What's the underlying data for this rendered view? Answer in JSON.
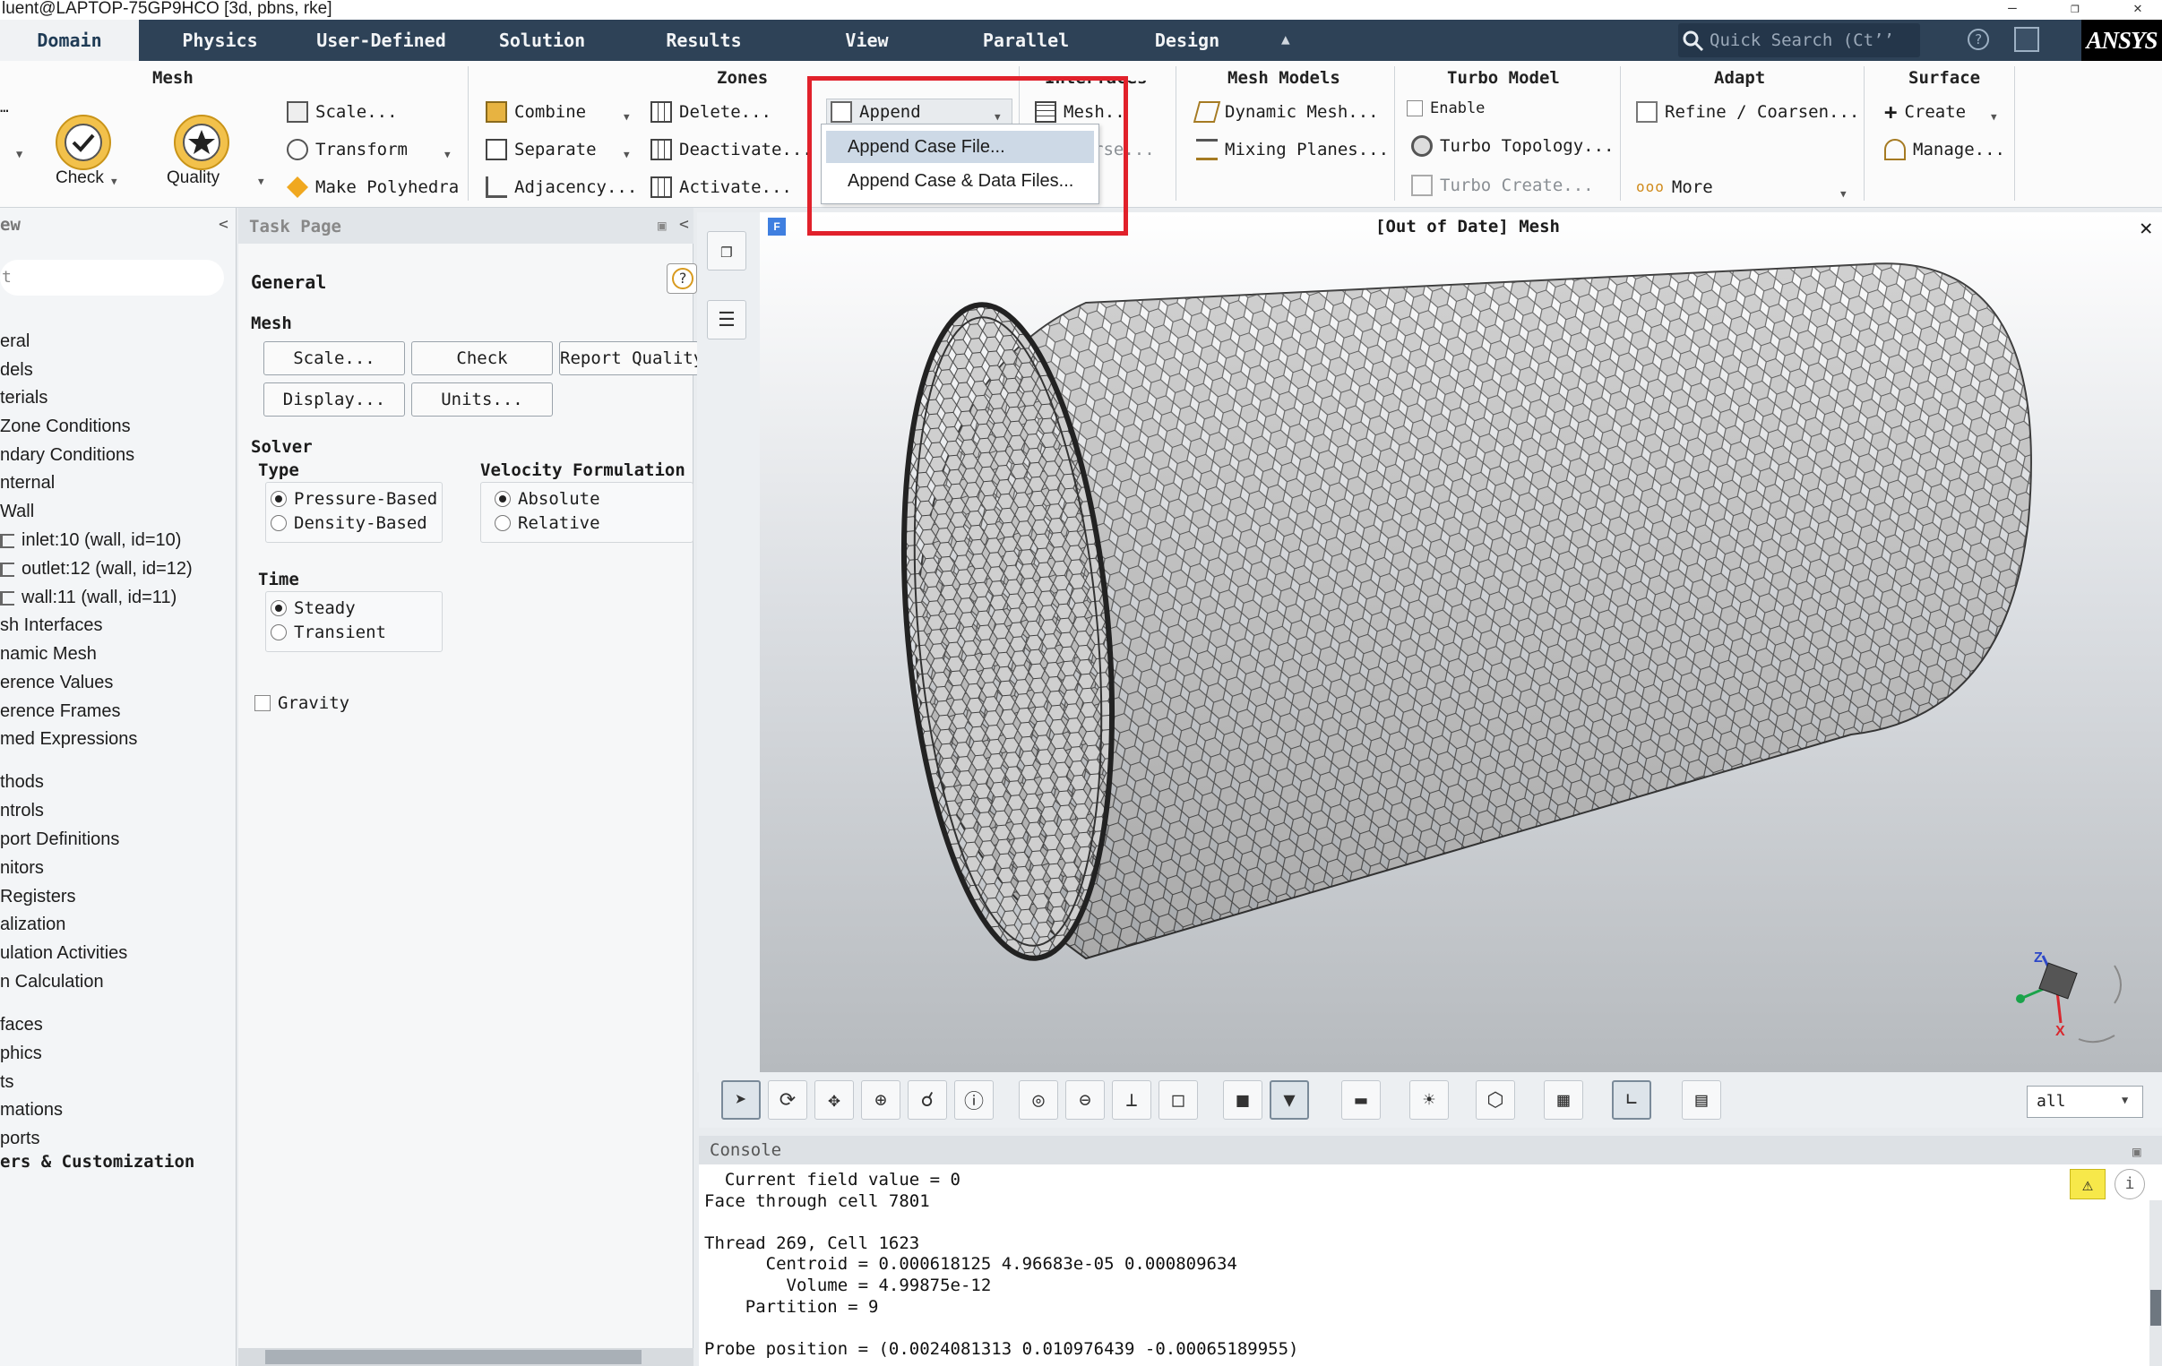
{
  "titlebar": {
    "text": "luent@LAPTOP-75GP9HCO  [3d, pbns, rke]"
  },
  "menubar": {
    "tabs": [
      "Domain",
      "Physics",
      "User-Defined",
      "Solution",
      "Results",
      "View",
      "Parallel",
      "Design"
    ],
    "active": "Domain",
    "search_placeholder": "Quick Search (Ct’’",
    "brand": "ANSYS"
  },
  "ribbon": {
    "mesh": {
      "title": "Mesh",
      "check": "Check",
      "quality": "Quality",
      "scale": "Scale...",
      "transform": "Transform",
      "make_polyhedra": "Make Polyhedra"
    },
    "zones": {
      "title": "Zones",
      "combine": "Combine",
      "separate": "Separate",
      "adjacency": "Adjacency...",
      "delete": "Delete...",
      "deactivate": "Deactivate...",
      "activate": "Activate...",
      "append": "Append"
    },
    "interfaces": {
      "title": "Interfaces",
      "mesh": "Mesh..",
      "overset": "rse..."
    },
    "mesh_models": {
      "title": "Mesh Models",
      "dynamic_mesh": "Dynamic Mesh...",
      "mixing_planes": "Mixing Planes..."
    },
    "turbo_model": {
      "title": "Turbo Model",
      "enable": "Enable",
      "turbo_topology": "Turbo Topology...",
      "turbo_create": "Turbo Create..."
    },
    "adapt": {
      "title": "Adapt",
      "refine": "Refine / Coarsen...",
      "more": "More"
    },
    "surface": {
      "title": "Surface",
      "create": "Create",
      "manage": "Manage..."
    }
  },
  "append_menu": {
    "items": [
      "Append Case File...",
      "Append Case & Data Files..."
    ],
    "hovered": "Append Case File..."
  },
  "tree": {
    "header": "ew",
    "search": "t",
    "items": [
      "eral",
      "dels",
      "terials",
      "Zone Conditions",
      "ndary Conditions",
      "nternal",
      "Wall",
      "inlet:10 (wall, id=10)",
      "outlet:12 (wall, id=12)",
      "wall:11 (wall, id=11)",
      "sh Interfaces",
      "namic Mesh",
      "erence Values",
      "erence Frames",
      "med Expressions",
      "thods",
      "ntrols",
      "port Definitions",
      "nitors",
      "Registers",
      "alization",
      "ulation Activities",
      "n Calculation",
      "faces",
      "phics",
      "ts",
      "mations",
      "ports",
      "ers & Customization"
    ]
  },
  "taskpage": {
    "header": "Task Page",
    "title": "General",
    "mesh_label": "Mesh",
    "buttons": [
      "Scale...",
      "Check",
      "Report Quality",
      "Display...",
      "Units..."
    ],
    "solver_label": "Solver",
    "type_label": "Type",
    "type_options": [
      "Pressure-Based",
      "Density-Based"
    ],
    "velocity_label": "Velocity Formulation",
    "velocity_options": [
      "Absolute",
      "Relative"
    ],
    "time_label": "Time",
    "time_options": [
      "Steady",
      "Transient"
    ],
    "gravity": "Gravity"
  },
  "viewport": {
    "title": "[Out of Date] Mesh",
    "badge": "F",
    "select_value": "all"
  },
  "console": {
    "header": "Console",
    "lines": [
      "  Current field value = 0",
      "Face through cell 7801",
      "",
      "Thread 269, Cell 1623",
      "      Centroid = 0.000618125 4.96683e-05 0.000809634",
      "        Volume = 4.99875e-12",
      "    Partition = 9",
      "",
      "Probe position = (0.0024081313 0.010976439 -0.00065189955)"
    ]
  }
}
